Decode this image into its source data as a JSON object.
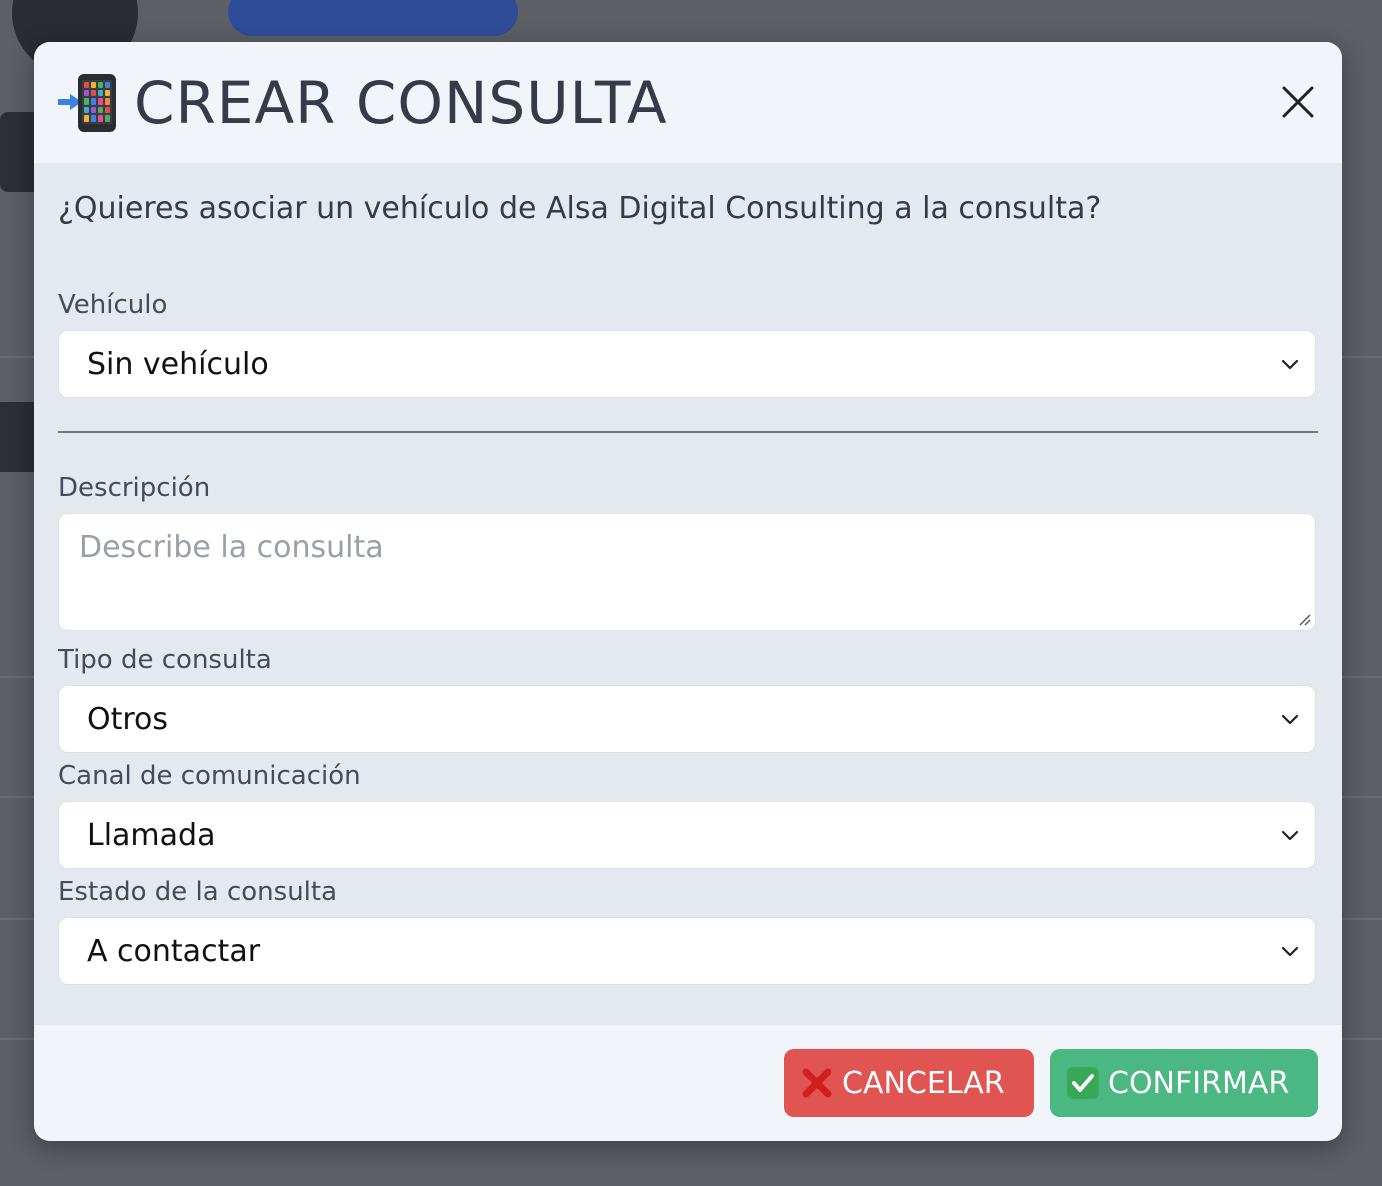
{
  "colors": {
    "overlay": "#5c5f66",
    "modal_body": "#e4e8ef",
    "modal_header": "#f1f4f9",
    "title_text": "#353b48",
    "cancel": "#e05452",
    "confirm": "#4bb783"
  },
  "modal": {
    "title_icon": "mobile-phone-with-arrow-icon",
    "title": "CREAR CONSULTA",
    "close_icon": "close-icon",
    "question": "¿Quieres asociar un vehículo de Alsa Digital Consulting a la consulta?",
    "vehicle": {
      "label": "Vehículo",
      "value": "Sin vehículo"
    },
    "description": {
      "label": "Descripción",
      "placeholder": "Describe la consulta",
      "value": ""
    },
    "query_type": {
      "label": "Tipo de consulta",
      "value": "Otros"
    },
    "channel": {
      "label": "Canal de comunicación",
      "value": "Llamada"
    },
    "status": {
      "label": "Estado de la consulta",
      "value": "A contactar"
    },
    "buttons": {
      "cancel_icon": "cross-mark-icon",
      "cancel_label": "CANCELAR",
      "confirm_icon": "check-mark-icon",
      "confirm_label": "CONFIRMAR"
    }
  }
}
